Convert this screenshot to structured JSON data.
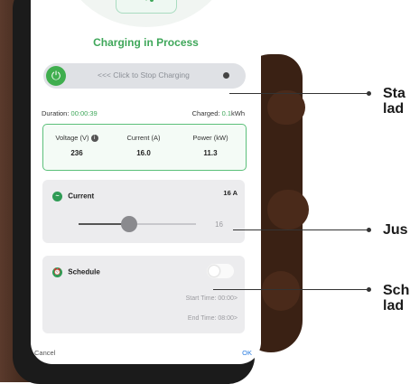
{
  "header": {
    "title": "Charging in Process"
  },
  "stop_bar": {
    "label": "<<< Click to Stop Charging",
    "icon": "power-icon"
  },
  "stats": {
    "duration_label": "Duration:",
    "duration_value": "00:00:39",
    "charged_label": "Charged:",
    "charged_value": "0.1",
    "charged_unit": "kWh"
  },
  "metrics": [
    {
      "label": "Voltage (V)",
      "value": "236"
    },
    {
      "label": "Current (A)",
      "value": "16.0"
    },
    {
      "label": "Power (kW)",
      "value": "11.3"
    }
  ],
  "current_card": {
    "title": "Current",
    "amps": "16 A",
    "slider_value": "16",
    "slider_fraction": 0.43
  },
  "schedule_card": {
    "title": "Schedule",
    "start_time": "Start Time: 00:00>",
    "end_time": "End Time: 08:00>",
    "toggle_on": false
  },
  "footer": {
    "cancel": "Cancel",
    "ok": "OK"
  },
  "callouts": [
    {
      "line1": "Sta",
      "line2": "lad"
    },
    {
      "line1": "Jus",
      "line2": ""
    },
    {
      "line1": "Sch",
      "line2": "lad"
    }
  ],
  "colors": {
    "accent_green": "#3fa75a",
    "ok_blue": "#2a7de1"
  }
}
